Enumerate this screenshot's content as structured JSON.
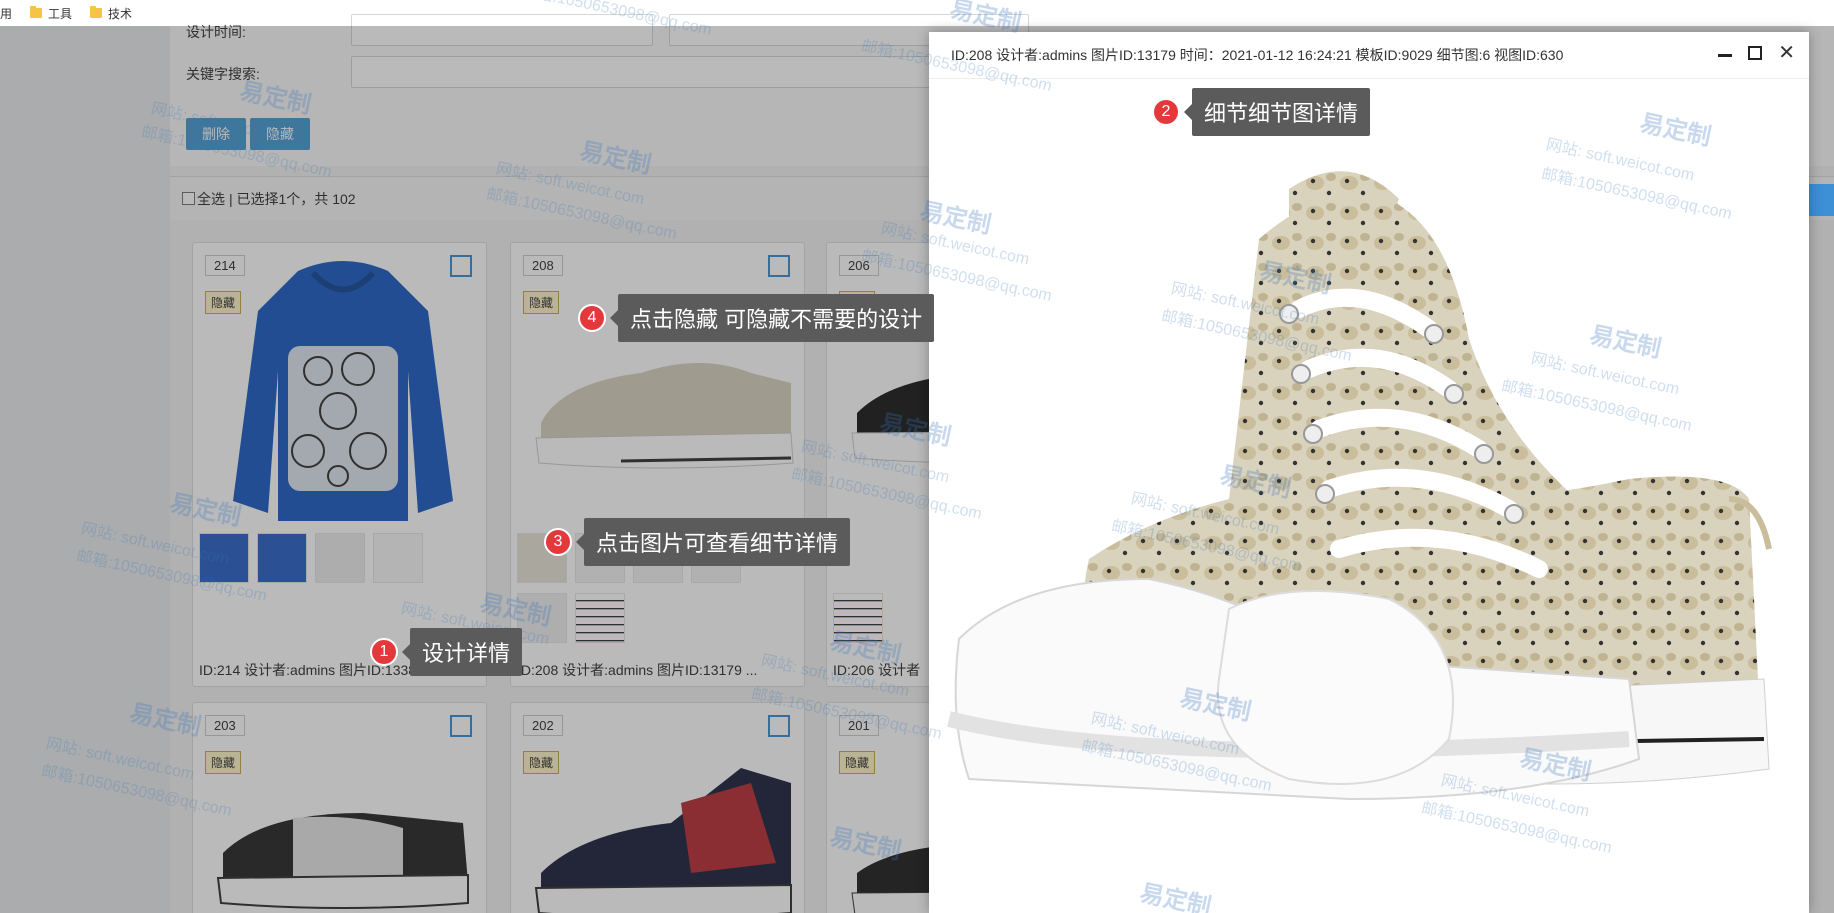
{
  "bookmarks": [
    {
      "label": "用"
    },
    {
      "label": "工具"
    },
    {
      "label": "技术"
    }
  ],
  "form": {
    "design_time_label": "设计时间:",
    "keyword_label": "关键字搜索:",
    "delete_button": "删除",
    "hide_button": "隐藏",
    "select_all_label": "全选",
    "selection_status": "| 已选择1个，共 102"
  },
  "cards": [
    {
      "id": "214",
      "hide_label": "隐藏",
      "caption": "ID:214 设计者:admins 图片ID:13388 ..."
    },
    {
      "id": "208",
      "hide_label": "隐藏",
      "caption": "ID:208 设计者:admins 图片ID:13179 ..."
    },
    {
      "id": "206",
      "hide_label": "隐藏",
      "caption": "ID:206 设计者"
    },
    {
      "id": "203",
      "hide_label": "隐藏"
    },
    {
      "id": "202",
      "hide_label": "隐藏"
    },
    {
      "id": "201",
      "hide_label": "隐藏"
    }
  ],
  "modal": {
    "title": "ID:208 设计者:admins 图片ID:13179 时间：2021-01-12 16:24:21 模板ID:9029 细节图:6 视图ID:630"
  },
  "tips": [
    {
      "num": "1",
      "label": "设计详情"
    },
    {
      "num": "2",
      "label": "细节细节图详情"
    },
    {
      "num": "3",
      "label": "点击图片可查看细节详情"
    },
    {
      "num": "4",
      "label": "点击隐藏 可隐藏不需要的设计"
    }
  ],
  "watermark": {
    "brand": "易定制",
    "site": "网站: soft.weicot.com",
    "mail": "邮箱:1050653098@qq.com"
  },
  "colors": {
    "accent": "#4b9bd1",
    "tip_badge": "#e4393c",
    "tip_bg": "#5b5b5b"
  }
}
